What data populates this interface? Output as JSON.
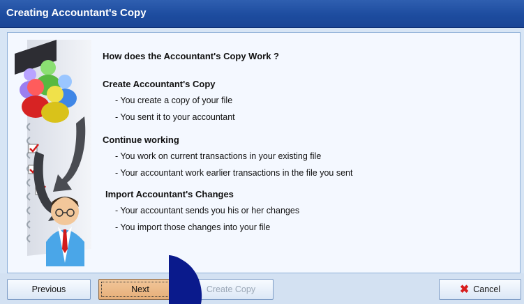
{
  "window": {
    "title": "Creating Accountant's Copy"
  },
  "content": {
    "heading": "How does the Accountant's Copy Work ?",
    "sections": [
      {
        "title": "Create Accountant's Copy",
        "bullets": [
          "- You create a copy of your file",
          "- You sent it to your accountant"
        ]
      },
      {
        "title": "Continue working",
        "bullets": [
          "- You work on current transactions in your existing file",
          "- Your accountant work earlier transactions in the file you sent"
        ]
      },
      {
        "title": "Import Accountant's Changes",
        "bullets": [
          "- Your accountant sends you his or her changes",
          "- You import those changes into your file"
        ]
      }
    ]
  },
  "buttons": {
    "previous": "Previous",
    "next": "Next",
    "create_copy": "Create Copy",
    "cancel": "Cancel"
  },
  "icons": {
    "illustration": "accountant-people-cycle-illustration",
    "cancel": "red-x-icon",
    "pointer": "mouse-pointer-icon"
  }
}
